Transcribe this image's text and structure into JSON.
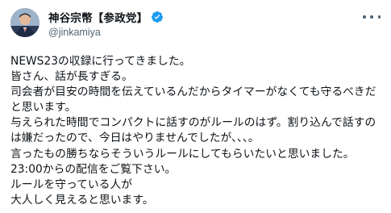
{
  "author": {
    "display_name": "神谷宗幣【参政党】",
    "handle": "@jinkamiya",
    "verified_color": "#1d9bf0"
  },
  "icons": {
    "avatar": "avatar-photo",
    "verified": "verified-badge-icon",
    "more": "more-options-icon"
  },
  "tweet": {
    "lines": [
      "NEWS23の収録に行ってきました。",
      "皆さん、話が長すぎる。",
      "司会者が目安の時間を伝えているんだからタイマーがなくても守るべきだ",
      "と思います。",
      "与えられた時間でコンパクトに話すのがルールのはず。割り込んで話すの",
      "は嫌だったので、今日はやりませんでしたが、、、。",
      "言ったもの勝ちならそういうルールにしてもらいたいと思いました。",
      "23:00からの配信をご覧下さい。",
      "ルールを守っている人が",
      "大人しく見えると思います。"
    ]
  }
}
